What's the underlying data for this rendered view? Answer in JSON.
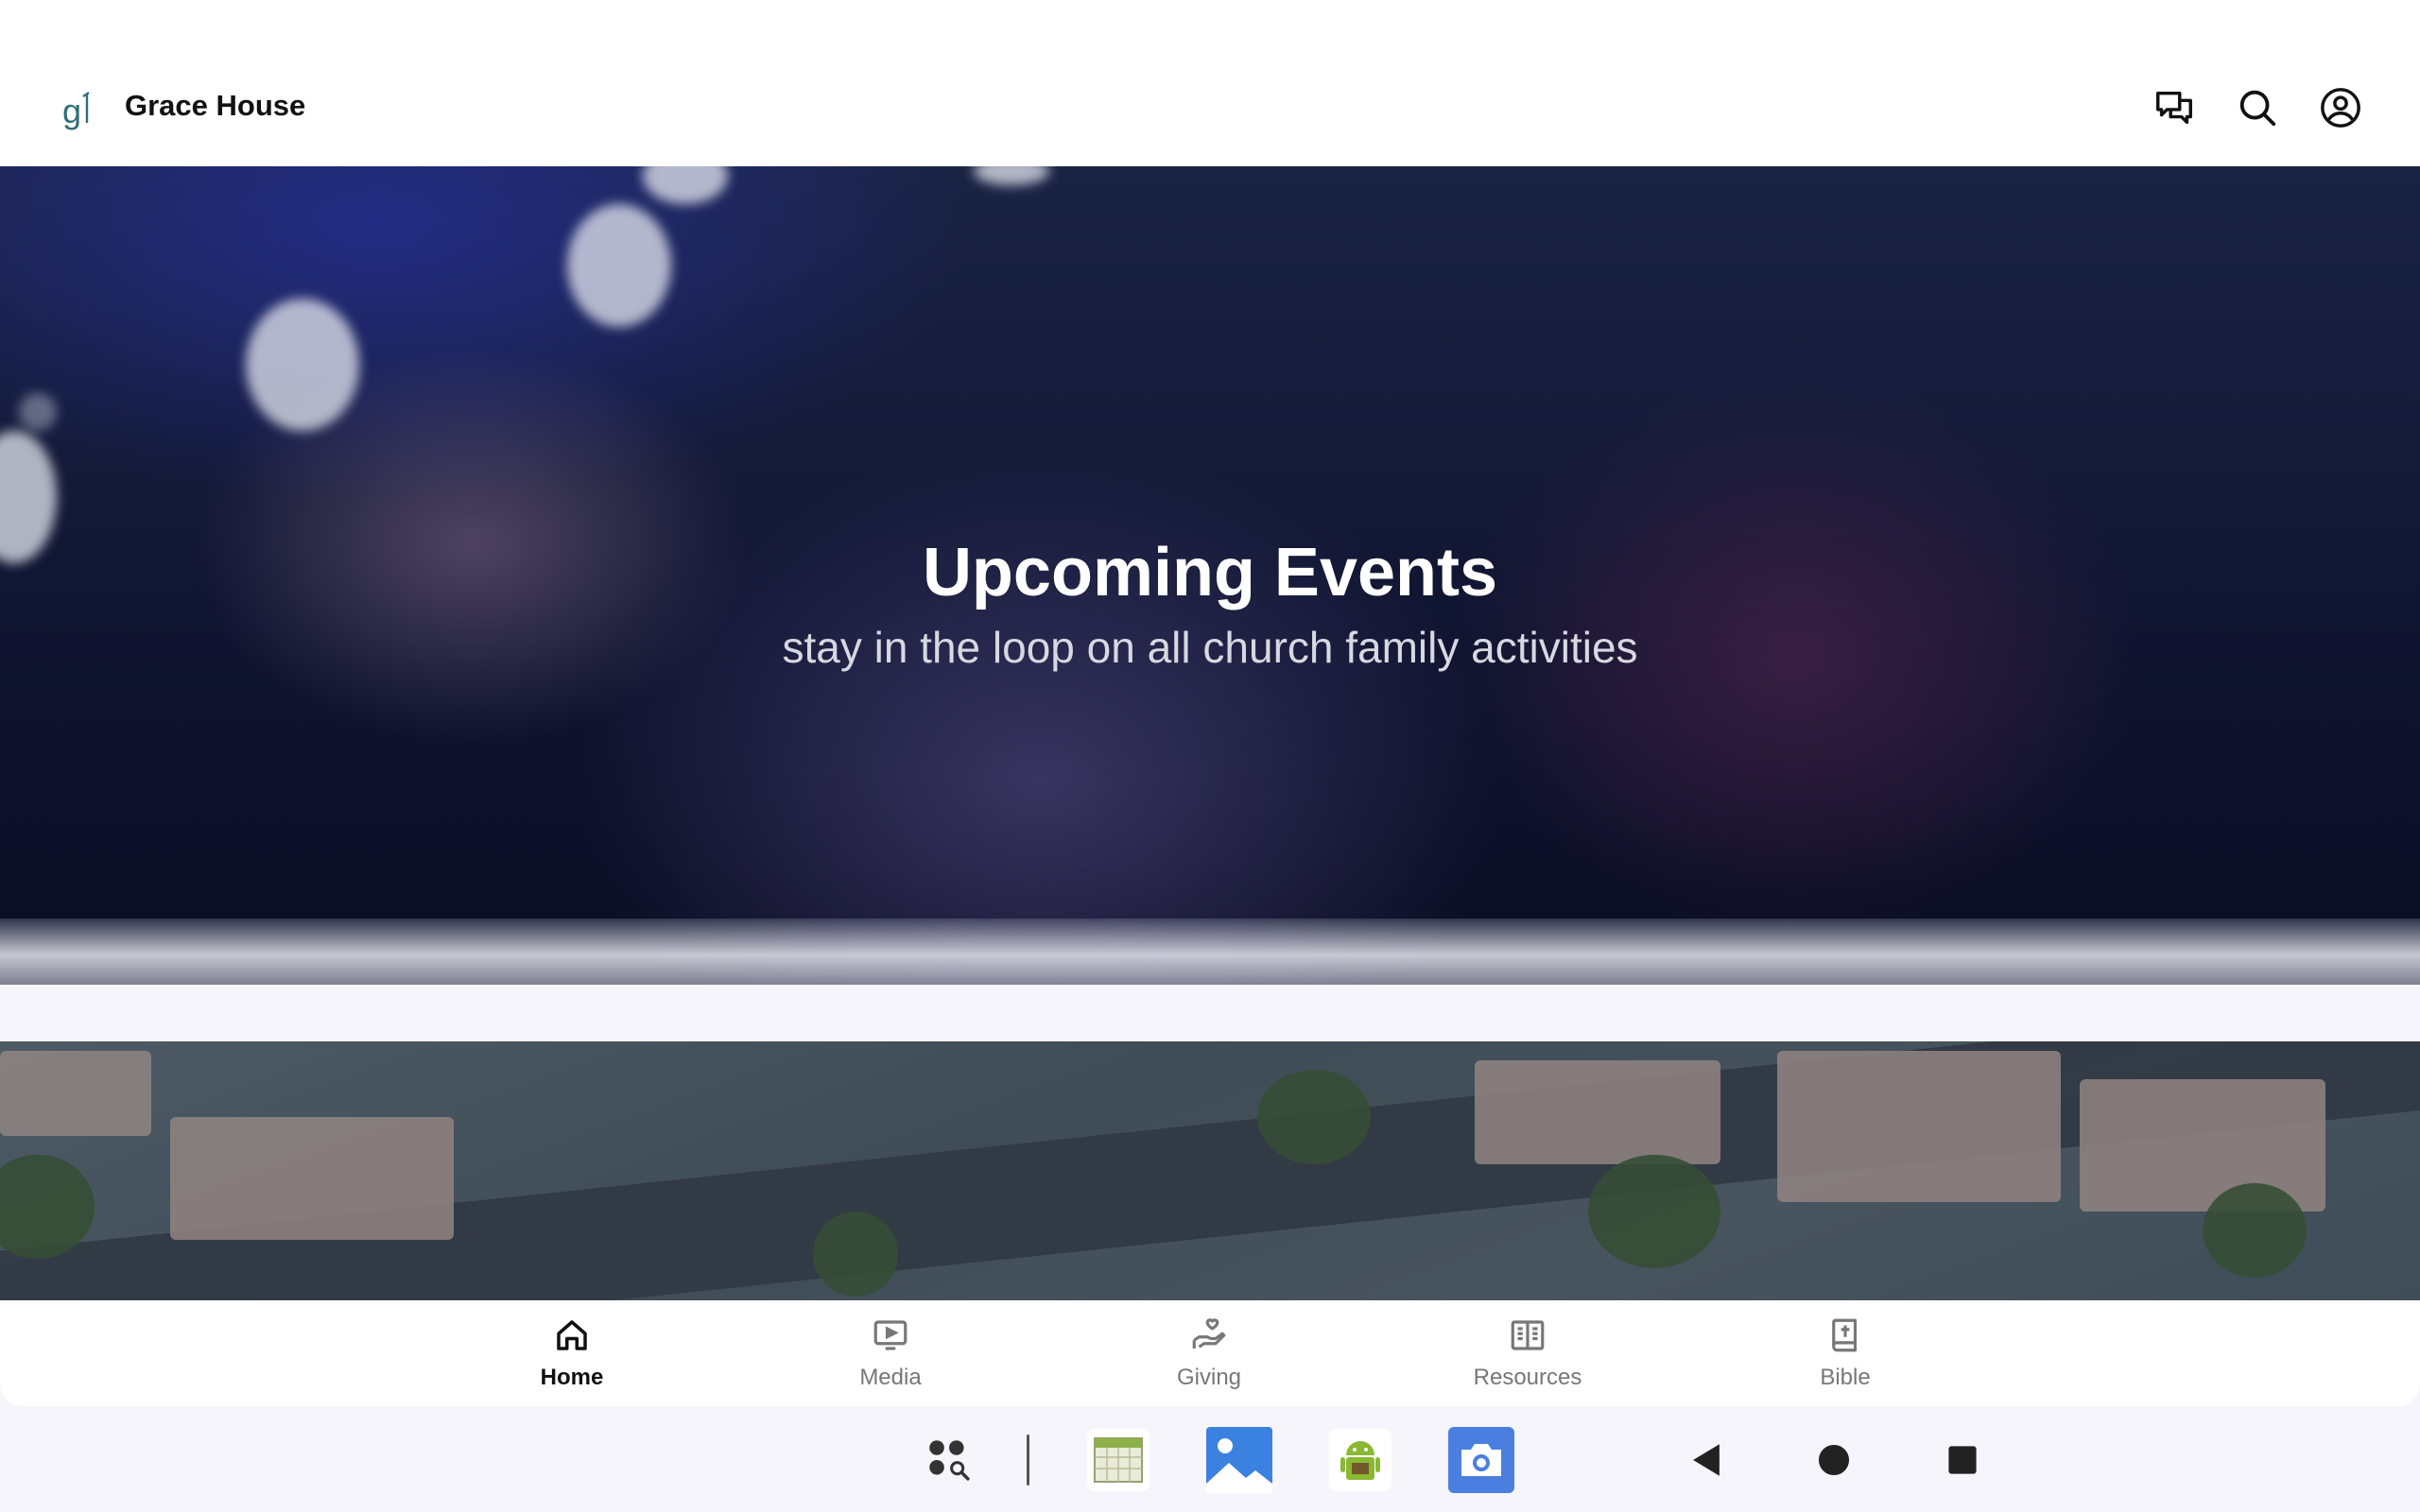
{
  "app": {
    "title": "Grace House"
  },
  "hero": {
    "title": "Upcoming Events",
    "subtitle": "stay in the loop on all church family activities"
  },
  "header_actions": {
    "icons": [
      "chat-icon",
      "search-icon",
      "account-icon"
    ]
  },
  "bottom_nav": {
    "items": [
      {
        "label": "Home",
        "icon": "home-icon",
        "active": true
      },
      {
        "label": "Media",
        "icon": "media-icon",
        "active": false
      },
      {
        "label": "Giving",
        "icon": "giving-icon",
        "active": false
      },
      {
        "label": "Resources",
        "icon": "resources-icon",
        "active": false
      },
      {
        "label": "Bible",
        "icon": "bible-icon",
        "active": false
      }
    ]
  },
  "taskbar": {
    "icons": [
      "app-drawer-icon",
      "calendar-app-icon",
      "gallery-app-icon",
      "android-app-icon",
      "camera-app-icon",
      "back-icon",
      "home-circle-icon",
      "recents-icon"
    ]
  },
  "colors": {
    "accent": "#111111",
    "inactive": "#777777",
    "logo": "#2f6f78",
    "camera": "#4a7fe0"
  }
}
